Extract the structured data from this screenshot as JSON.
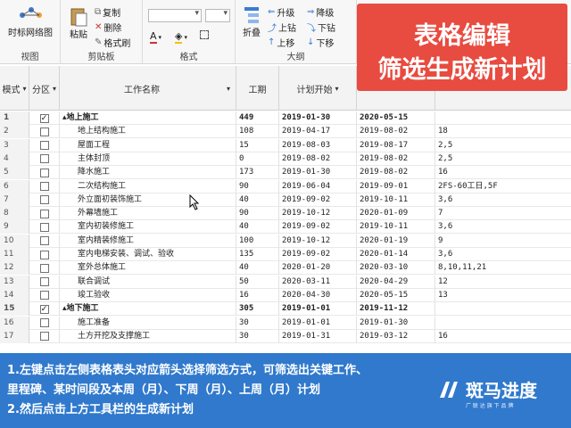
{
  "ribbon": {
    "groups": {
      "view": "视图",
      "clipboard": "剪贴板",
      "format": "格式",
      "outline": "大纲"
    },
    "timescale_label": "时标网络图",
    "paste_label": "粘贴",
    "copy_label": "复制",
    "delete_label": "删除",
    "format_painter_label": "格式刷",
    "collapse_label": "折叠",
    "upgrade_label": "升级",
    "downgrade_label": "降级",
    "up_drill_label": "上钻",
    "down_drill_label": "下钻",
    "move_up_label": "上移",
    "move_down_label": "下移"
  },
  "callout": {
    "line1": "表格编辑",
    "line2": "筛选生成新计划"
  },
  "table": {
    "headers": {
      "mode": "模式",
      "partition": "分区",
      "name": "工作名称",
      "duration": "工期",
      "start": "计划开始"
    },
    "rows": [
      {
        "num": "1",
        "checked": "✓",
        "name": "▴地上施工",
        "dur": "449",
        "start": "2019-01-30",
        "end": "2020-05-15",
        "pred": ""
      },
      {
        "num": "2",
        "checked": "",
        "name": "地上结构施工",
        "dur": "108",
        "start": "2019-04-17",
        "end": "2019-08-02",
        "pred": "18"
      },
      {
        "num": "3",
        "checked": "",
        "name": "屋面工程",
        "dur": "15",
        "start": "2019-08-03",
        "end": "2019-08-17",
        "pred": "2,5"
      },
      {
        "num": "4",
        "checked": "",
        "name": "主体封顶",
        "dur": "0",
        "start": "2019-08-02",
        "end": "2019-08-02",
        "pred": "2,5"
      },
      {
        "num": "5",
        "checked": "",
        "name": "降水施工",
        "dur": "173",
        "start": "2019-01-30",
        "end": "2019-08-02",
        "pred": "16"
      },
      {
        "num": "6",
        "checked": "",
        "name": "二次结构施工",
        "dur": "90",
        "start": "2019-06-04",
        "end": "2019-09-01",
        "pred": "2FS-60工日,5F"
      },
      {
        "num": "7",
        "checked": "",
        "name": "外立面初装饰施工",
        "dur": "40",
        "start": "2019-09-02",
        "end": "2019-10-11",
        "pred": "3,6"
      },
      {
        "num": "8",
        "checked": "",
        "name": "外幕墙施工",
        "dur": "90",
        "start": "2019-10-12",
        "end": "2020-01-09",
        "pred": "7"
      },
      {
        "num": "9",
        "checked": "",
        "name": "室内初装修施工",
        "dur": "40",
        "start": "2019-09-02",
        "end": "2019-10-11",
        "pred": "3,6"
      },
      {
        "num": "10",
        "checked": "",
        "name": "室内精装修施工",
        "dur": "100",
        "start": "2019-10-12",
        "end": "2020-01-19",
        "pred": "9"
      },
      {
        "num": "11",
        "checked": "",
        "name": "室内电梯安装、调试、验收",
        "dur": "135",
        "start": "2019-09-02",
        "end": "2020-01-14",
        "pred": "3,6"
      },
      {
        "num": "12",
        "checked": "",
        "name": "室外总体施工",
        "dur": "40",
        "start": "2020-01-20",
        "end": "2020-03-10",
        "pred": "8,10,11,21"
      },
      {
        "num": "13",
        "checked": "",
        "name": "联合调试",
        "dur": "50",
        "start": "2020-03-11",
        "end": "2020-04-29",
        "pred": "12"
      },
      {
        "num": "14",
        "checked": "",
        "name": "竣工验收",
        "dur": "16",
        "start": "2020-04-30",
        "end": "2020-05-15",
        "pred": "13"
      },
      {
        "num": "15",
        "checked": "✓",
        "name": "▴地下施工",
        "dur": "305",
        "start": "2019-01-01",
        "end": "2019-11-12",
        "pred": ""
      },
      {
        "num": "16",
        "checked": "",
        "name": "施工准备",
        "dur": "30",
        "start": "2019-01-01",
        "end": "2019-01-30",
        "pred": ""
      },
      {
        "num": "17",
        "checked": "",
        "name": "土方开挖及支撑施工",
        "dur": "30",
        "start": "2019-01-31",
        "end": "2019-03-12",
        "pred": "16"
      }
    ]
  },
  "banner": {
    "line1": "1.左键点击左侧表格表头对应箭头选择筛选方式，可筛选出关键工作、",
    "line2": "里程碑、某时间段及本周（月）、下周（月）、上周（月）计划",
    "line3": "2.然后点击上方工具栏的生成新计划",
    "brand_name": "斑马进度",
    "brand_slogan": "广 联 达 旗 下 品 牌"
  },
  "colors": {
    "accent_red": "#e84b40",
    "banner_blue": "#1e6ec8"
  }
}
